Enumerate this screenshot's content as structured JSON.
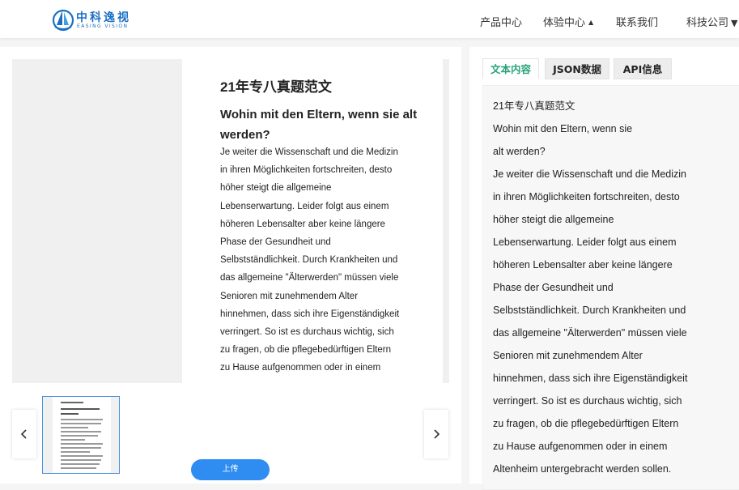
{
  "header": {
    "logo_cn": "中科逸视",
    "logo_en": "EASING VISION",
    "nav": [
      {
        "label": "产品中心"
      },
      {
        "label": "体验中心"
      },
      {
        "label": "联系我们"
      },
      {
        "label": "科技公司"
      }
    ]
  },
  "document": {
    "title": "21年专八真题范文",
    "subtitle": "Wohin mit den Eltern, wenn sie alt werden?",
    "lines": [
      "Je weiter die Wissenschaft und die Medizin",
      "in ihren Möglichkeiten fortschreiten, desto",
      "höher steigt die allgemeine",
      "Lebenserwartung. Leider folgt aus einem",
      "höheren Lebensalter aber keine längere",
      "Phase der Gesundheit und",
      "Selbstständlichkeit. Durch Krankheiten und",
      "das allgemeine \"Älterwerden\" müssen viele",
      "Senioren mit zunehmendem Alter",
      "hinnehmen, dass sich ihre Eigenständigkeit",
      "verringert. So ist es durchaus wichtig, sich",
      "zu fragen, ob die pflegebedürftigen Eltern",
      "zu Hause aufgenommen oder in einem"
    ]
  },
  "controls": {
    "prev_icon": "chevron-left-icon",
    "next_icon": "chevron-right-icon",
    "upload_label": "上传"
  },
  "tabs": [
    {
      "label": "文本内容",
      "active": true
    },
    {
      "label": "JSON数据",
      "active": false
    },
    {
      "label": "API信息",
      "active": false
    }
  ],
  "result": {
    "lines": [
      "21年专八真题范文",
      "Wohin mit den Eltern, wenn sie",
      "alt werden?",
      "Je weiter die Wissenschaft und die Medizin",
      "in ihren Möglichkeiten fortschreiten, desto",
      "höher steigt die allgemeine",
      "Lebenserwartung. Leider folgt aus einem",
      "höheren Lebensalter aber keine längere",
      "Phase der Gesundheit und",
      "Selbstständlichkeit. Durch Krankheiten und",
      "das allgemeine \"Älterwerden\" müssen viele",
      "Senioren mit zunehmendem Alter",
      "hinnehmen, dass sich ihre Eigenständigkeit",
      "verringert. So ist es durchaus wichtig, sich",
      "zu fragen, ob die pflegebedürftigen Eltern",
      "zu Hause aufgenommen oder in einem",
      "Altenheim untergebracht werden sollen."
    ]
  },
  "colors": {
    "brand": "#1b6fc4",
    "accent_tab": "#27a37a",
    "upload_button": "#2f8cf0"
  }
}
